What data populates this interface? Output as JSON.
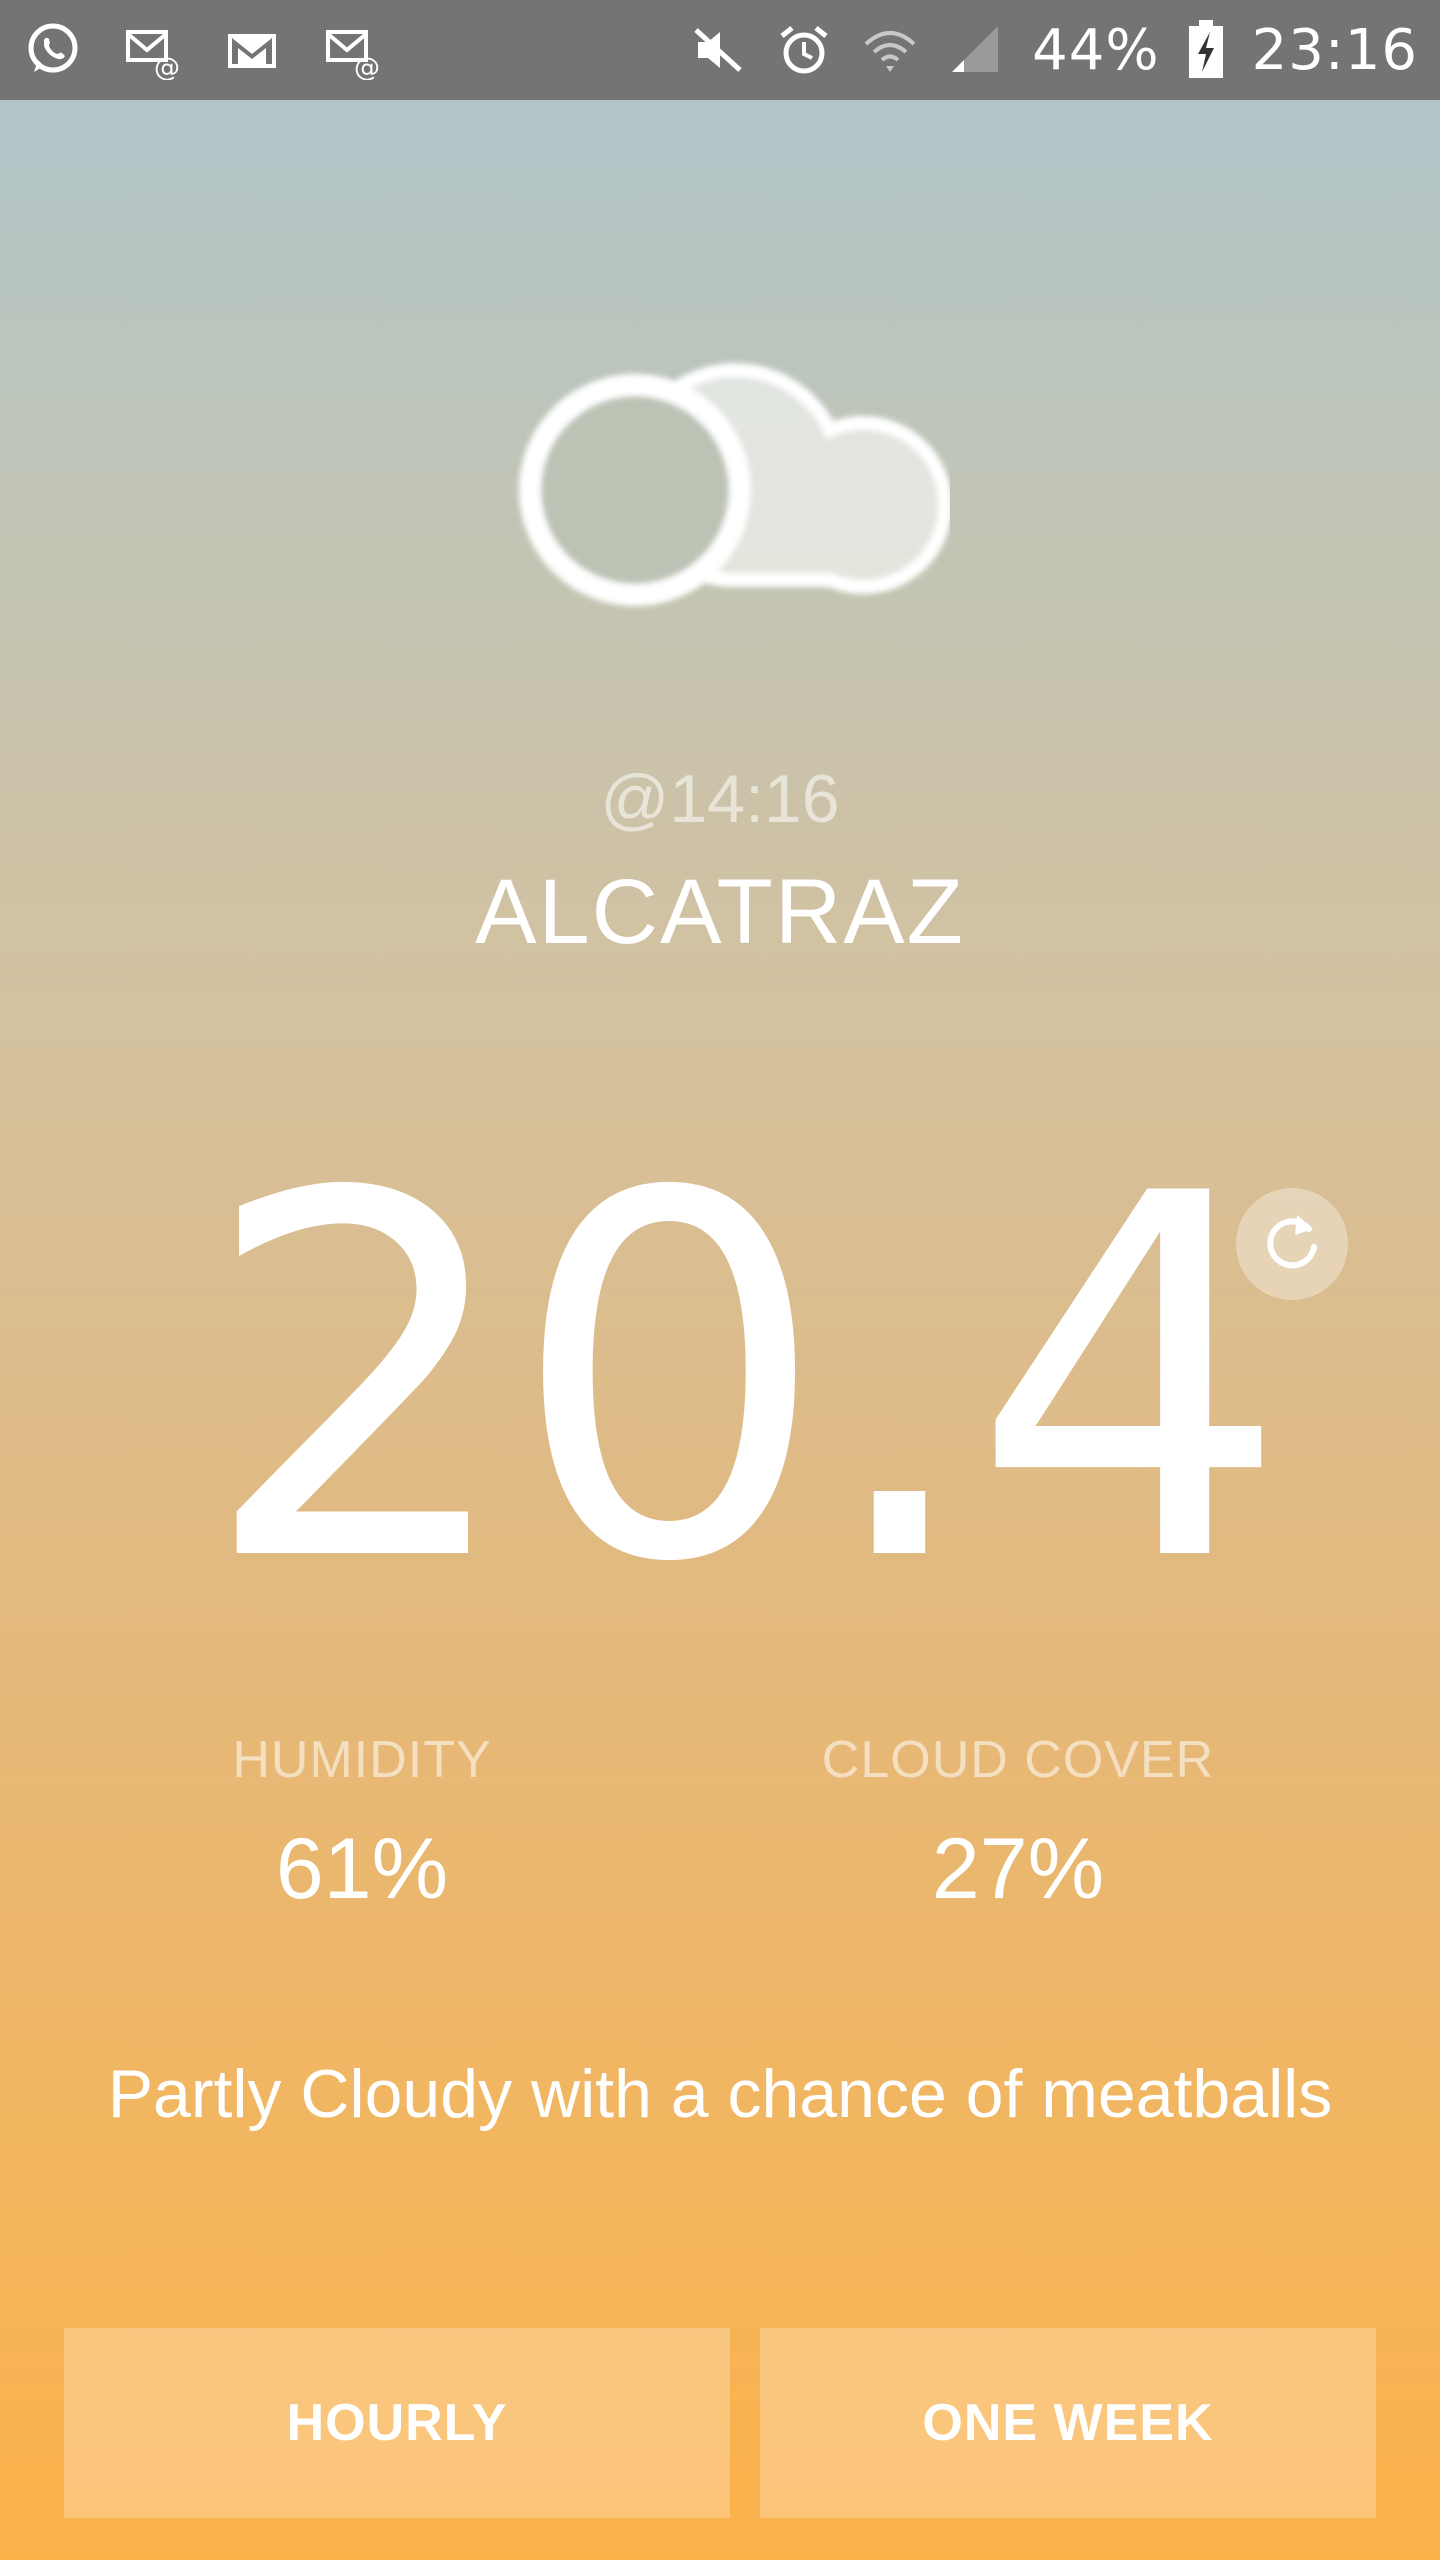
{
  "status_bar": {
    "battery_percent": "44%",
    "time": "23:16",
    "left_icons": [
      "whatsapp-icon",
      "email-icon",
      "gmail-icon",
      "email-icon"
    ],
    "right_icons": [
      "mute-icon",
      "alarm-icon",
      "wifi-icon",
      "signal-icon",
      "battery-charging-icon"
    ]
  },
  "weather": {
    "icon": "partly-cloudy-icon",
    "updated_time": "@14:16",
    "location": "ALCATRAZ",
    "temperature": "20.4",
    "humidity_label": "HUMIDITY",
    "humidity_value": "61%",
    "cloud_cover_label": "CLOUD COVER",
    "cloud_cover_value": "27%",
    "summary": "Partly Cloudy with a chance of meatballs"
  },
  "buttons": {
    "hourly": "HOURLY",
    "one_week": "ONE WEEK"
  },
  "colors": {
    "status_bar": "#747474",
    "gradient_top": "#aec4cd",
    "gradient_bottom": "#fbb14a",
    "text": "#ffffff"
  }
}
